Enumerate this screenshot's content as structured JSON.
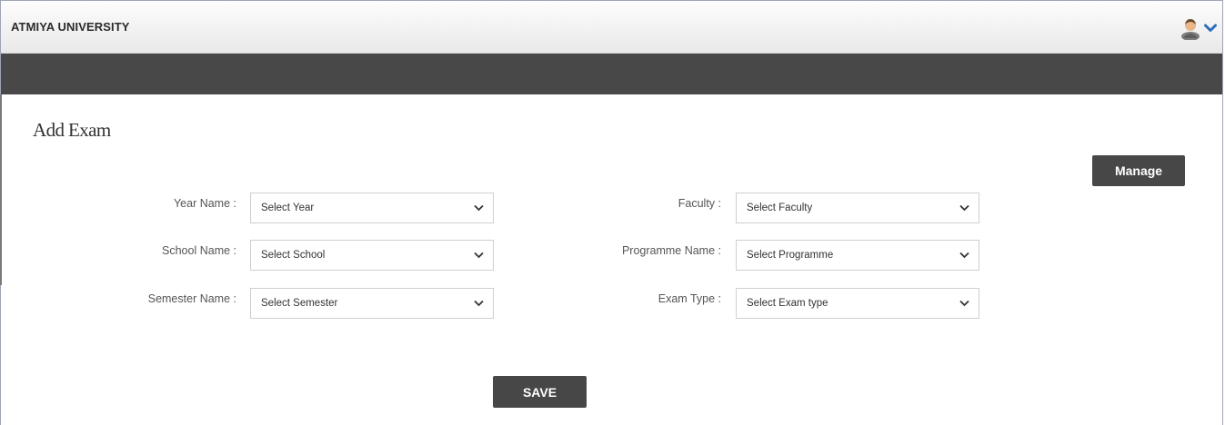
{
  "header": {
    "brand": "ATMIYA UNIVERSITY",
    "user_icon": "user-avatar-icon",
    "menu_icon": "chevron-down-icon"
  },
  "page": {
    "title": "Add Exam"
  },
  "buttons": {
    "manage": "Manage",
    "save": "SAVE"
  },
  "form": {
    "year": {
      "label": "Year Name :",
      "value": "Select Year"
    },
    "school": {
      "label": "School Name :",
      "value": "Select School"
    },
    "semester": {
      "label": "Semester Name :",
      "value": "Select Semester"
    },
    "faculty": {
      "label": "Faculty :",
      "value": "Select Faculty"
    },
    "programme": {
      "label": "Programme Name :",
      "value": "Select Programme"
    },
    "exam_type": {
      "label": "Exam Type :",
      "value": "Select Exam type"
    }
  },
  "colors": {
    "navbar": "#484848",
    "button": "#474747",
    "accent": "#2a6ebb"
  }
}
